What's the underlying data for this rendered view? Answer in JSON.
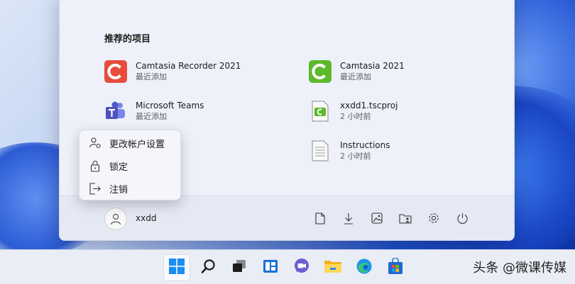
{
  "start_menu": {
    "section_title": "推荐的项目",
    "recommended": [
      {
        "name": "Camtasia Recorder 2021",
        "sub": "最近添加",
        "icon": "camtasia-recorder-icon"
      },
      {
        "name": "Camtasia 2021",
        "sub": "最近添加",
        "icon": "camtasia-icon"
      },
      {
        "name": "Microsoft Teams",
        "sub": "最近添加",
        "icon": "teams-icon"
      },
      {
        "name": "xxdd1.tscproj",
        "sub": "2 小时前",
        "icon": "tscproj-file-icon"
      },
      {
        "name": "Instructions",
        "sub": "2 小时前",
        "icon": "document-file-icon"
      }
    ],
    "user": {
      "name": "xxdd",
      "icon": "user-avatar-icon"
    },
    "footer_icons": [
      "documents-icon",
      "downloads-icon",
      "pictures-icon",
      "personal-folder-icon",
      "settings-icon",
      "power-icon"
    ]
  },
  "account_menu": {
    "items": [
      {
        "label": "更改帐户设置",
        "icon": "account-settings-icon"
      },
      {
        "label": "锁定",
        "icon": "lock-icon"
      },
      {
        "label": "注销",
        "icon": "sign-out-icon"
      }
    ]
  },
  "taskbar": {
    "items": [
      "start-icon",
      "search-icon",
      "task-view-icon",
      "widgets-icon",
      "teams-chat-icon",
      "file-explorer-icon",
      "edge-icon",
      "store-icon"
    ]
  },
  "watermark": "头条 @微课传媒",
  "colors": {
    "camtasia_recorder": "#e74c3c",
    "camtasia": "#5cb82c",
    "accent": "#0067c0"
  }
}
